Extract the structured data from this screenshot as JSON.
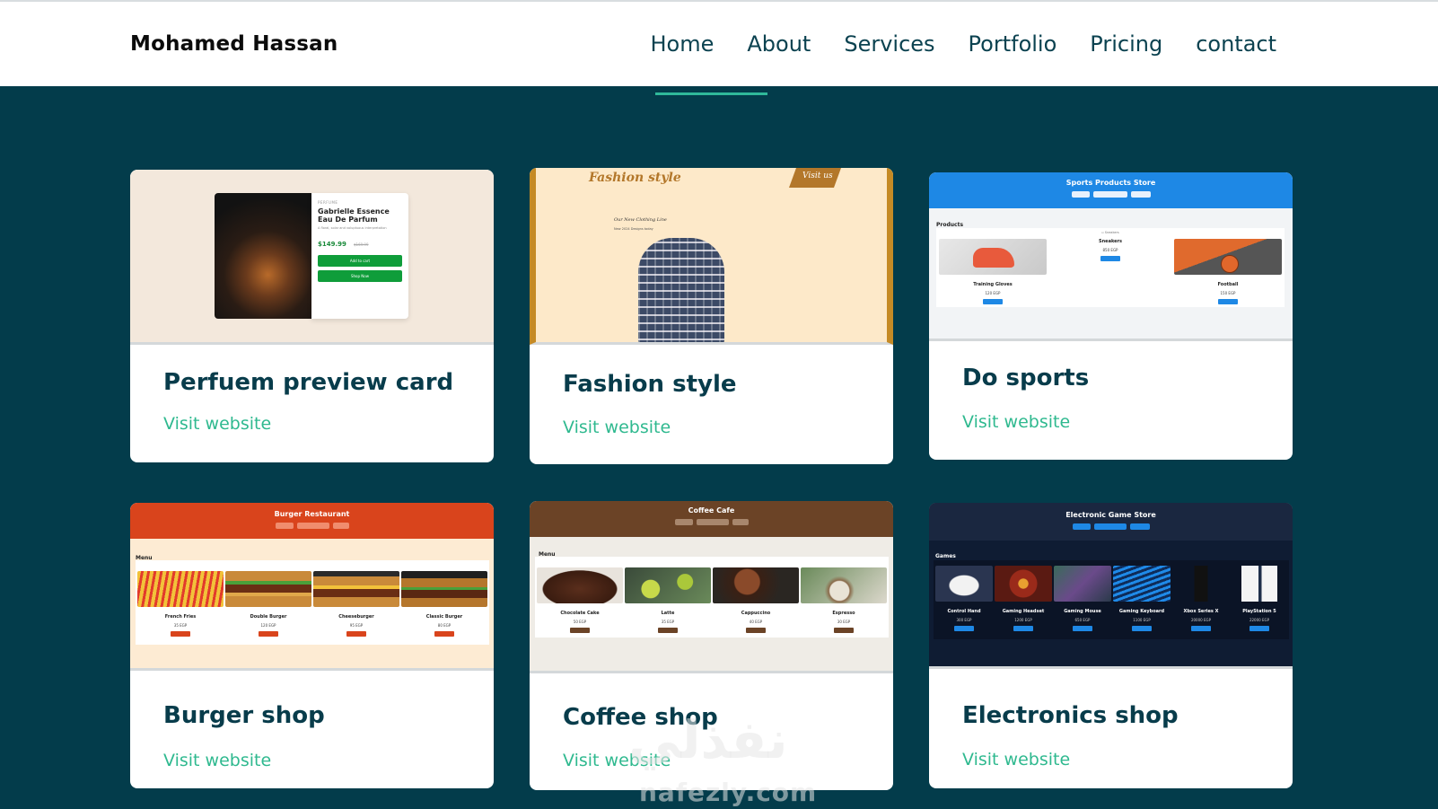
{
  "header": {
    "brand": "Mohamed Hassan",
    "nav": [
      "Home",
      "About",
      "Services",
      "Portfolio",
      "Pricing",
      "contact"
    ]
  },
  "cards": [
    {
      "title": "Perfuem preview card",
      "link": "Visit website",
      "preview": {
        "category": "PERFUME",
        "name_line1": "Gabrielle Essence",
        "name_line2": "Eau De Parfum",
        "desc": "A floral, solar and voluptuous interpretation",
        "price": "$149.99",
        "old_price": "$169.99",
        "btn_cart": "Add to cart",
        "btn_shop": "Shop Now"
      }
    },
    {
      "title": "Fashion style",
      "link": "Visit website",
      "preview": {
        "heading": "Fashion style",
        "visit": "Visit us",
        "line": "Our New Clothing Line",
        "sub": "New 2024 Designs today"
      }
    },
    {
      "title": "Do sports",
      "link": "Visit website",
      "preview": {
        "header": "Sports Products Store",
        "buttons": [
          "Log out",
          "Shopping Cart",
          "Products"
        ],
        "section": "Products",
        "products": [
          {
            "name": "Training Gloves",
            "price": "120 EGP"
          },
          {
            "name": "Sneakers",
            "price": "850 EGP"
          },
          {
            "name": "Football",
            "price": "150 EGP"
          }
        ]
      }
    },
    {
      "title": "Burger shop",
      "link": "Visit website",
      "preview": {
        "header": "Burger Restaurant",
        "buttons": [
          "Log out",
          "Shopping Cart",
          "Menu"
        ],
        "section": "Menu",
        "products": [
          {
            "name": "French Fries",
            "price": "35 EGP"
          },
          {
            "name": "Double Burger",
            "price": "120 EGP"
          },
          {
            "name": "Cheeseburger",
            "price": "95 EGP"
          },
          {
            "name": "Classic Burger",
            "price": "80 EGP"
          }
        ]
      }
    },
    {
      "title": "Coffee shop",
      "link": "Visit website",
      "preview": {
        "header": "Coffee Cafe",
        "buttons": [
          "Log out",
          "Shopping Cart",
          "Menu"
        ],
        "section": "Menu",
        "products": [
          {
            "name": "Chocolate Cake",
            "price": "50 EGP"
          },
          {
            "name": "Latte",
            "price": "35 EGP"
          },
          {
            "name": "Cappuccino",
            "price": "40 EGP"
          },
          {
            "name": "Espresso",
            "price": "30 EGP"
          }
        ]
      }
    },
    {
      "title": "Electronics shop",
      "link": "Visit website",
      "preview": {
        "header": "Electronic Game Store",
        "buttons": [
          "Log out",
          "Shopping Cart",
          "Products"
        ],
        "section": "Games",
        "products": [
          {
            "name": "Control Hand",
            "price": "300 EGP"
          },
          {
            "name": "Gaming Headset",
            "price": "1200 EGP"
          },
          {
            "name": "Gaming Mouse",
            "price": "650 EGP"
          },
          {
            "name": "Gaming Keyboard",
            "price": "1100 EGP"
          },
          {
            "name": "Xbox Series X",
            "price": "20000 EGP"
          },
          {
            "name": "PlayStation 5",
            "price": "22000 EGP"
          }
        ]
      }
    }
  ],
  "watermark": {
    "arabic": "نفذلي",
    "latin": "nafezly.com"
  }
}
